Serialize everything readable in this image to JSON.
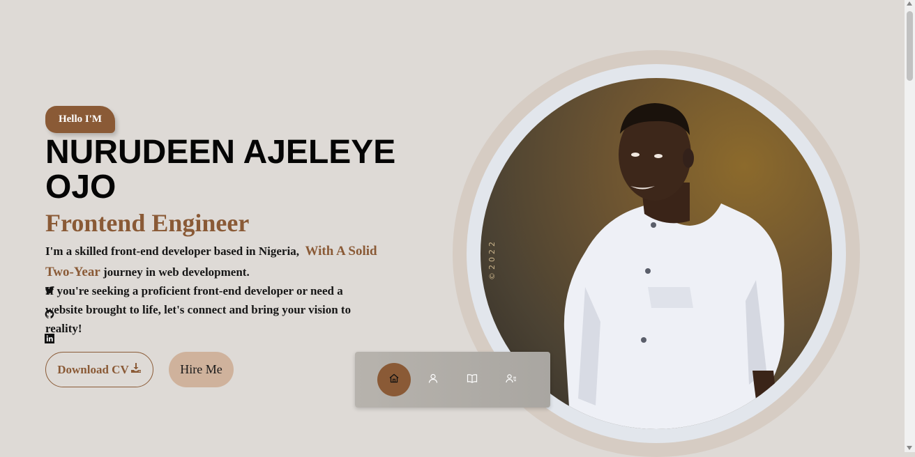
{
  "hero": {
    "badge": "Hello I'M",
    "name": "NURUDEEN AJELEYE OJO",
    "role": "Frontend Engineer",
    "intro_prefix": "I'm a skilled front-end developer based in Nigeria,",
    "intro_accent": "With A Solid Two-Year",
    "intro_suffix": "journey in web development.",
    "pitch": "If you're seeking a proficient front-end developer or need a website brought to life, let's connect and bring your vision to reality!"
  },
  "social": [
    {
      "name": "twitter",
      "icon": "twitter-icon"
    },
    {
      "name": "github",
      "icon": "github-icon"
    },
    {
      "name": "linkedin",
      "icon": "linkedin-icon"
    }
  ],
  "buttons": {
    "download_cv": "Download CV",
    "hire_me": "Hire Me"
  },
  "portrait": {
    "copyright": "©2022"
  },
  "nav": {
    "items": [
      {
        "id": "home",
        "icon": "home-icon",
        "active": true
      },
      {
        "id": "about",
        "icon": "user-icon",
        "active": false
      },
      {
        "id": "resume",
        "icon": "book-icon",
        "active": false
      },
      {
        "id": "contact",
        "icon": "contact-list-icon",
        "active": false
      }
    ]
  },
  "colors": {
    "background": "#dedad6",
    "accent": "#8a5a36",
    "hire_button": "#cfb29c"
  }
}
